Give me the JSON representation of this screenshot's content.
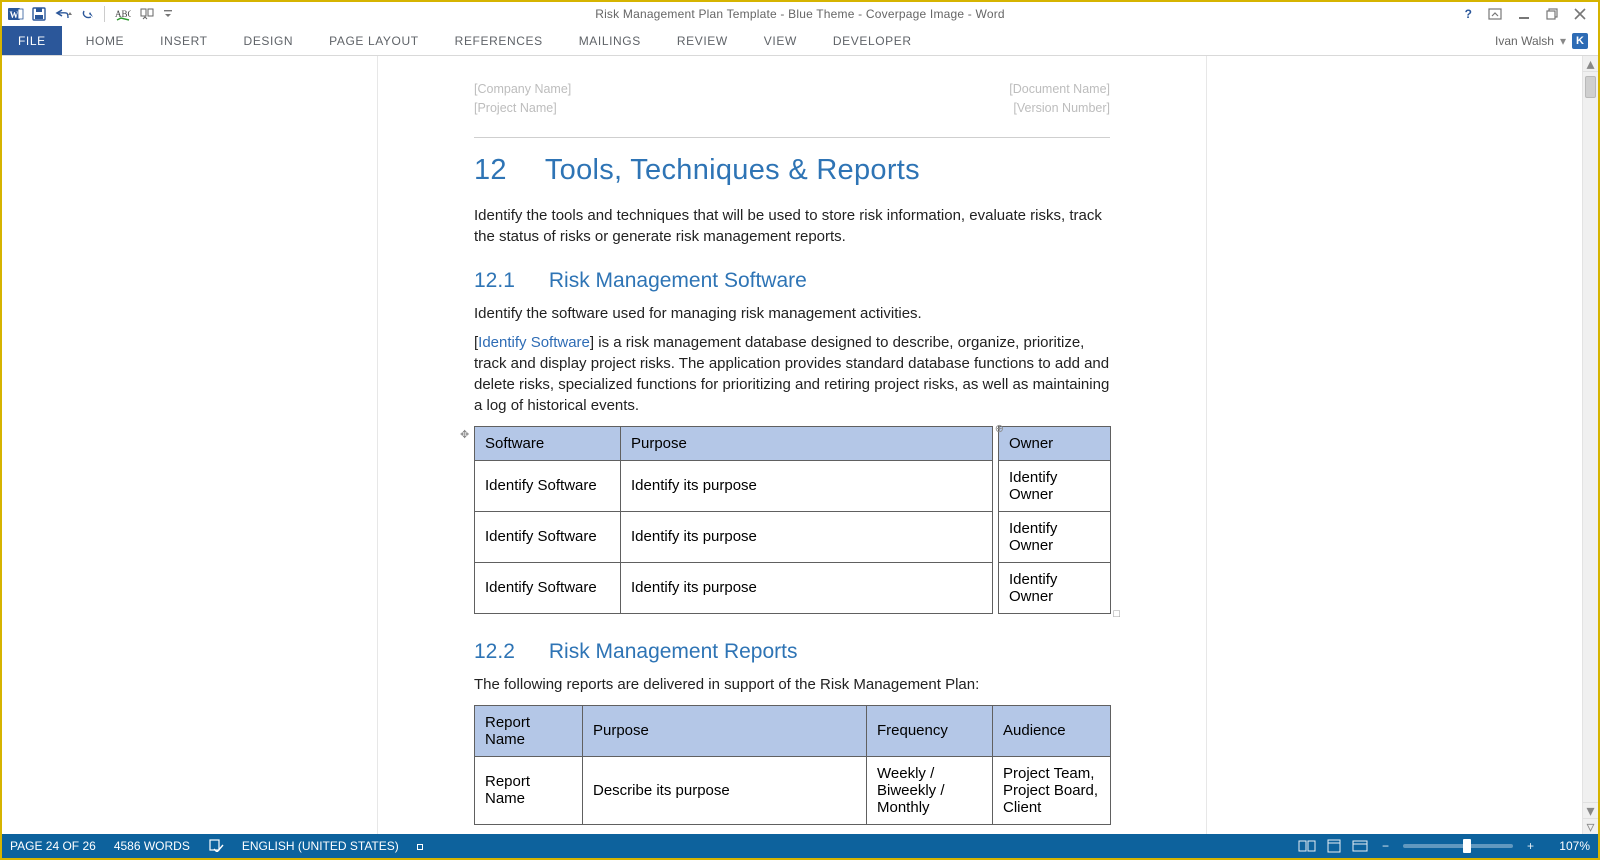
{
  "title_bar": {
    "title": "Risk Management Plan Template - Blue Theme - Coverpage Image - Word"
  },
  "ribbon": {
    "tabs": [
      "FILE",
      "HOME",
      "INSERT",
      "DESIGN",
      "PAGE LAYOUT",
      "REFERENCES",
      "MAILINGS",
      "REVIEW",
      "VIEW",
      "DEVELOPER"
    ],
    "user_name": "Ivan Walsh",
    "user_initial": "K"
  },
  "document": {
    "header": {
      "company": "[Company Name]",
      "project": "[Project Name]",
      "docname": "[Document Name]",
      "version": "[Version Number]"
    },
    "h1_num": "12",
    "h1_text": "Tools, Techniques & Reports",
    "p12_intro": "Identify the tools and techniques that will be used to store risk information, evaluate risks, track the status of risks or generate risk management reports.",
    "h121_num": "12.1",
    "h121_text": "Risk Management Software",
    "p121_a": "Identify the software used for managing risk management activities.",
    "p121_b_prefix": "[",
    "p121_b_field": "Identify Software",
    "p121_b_rest": "] is a risk management database designed to describe, organize, prioritize, track and display project risks. The application provides standard database functions to add and delete risks, specialized functions for prioritizing and retiring project risks, as well as maintaining a log of historical events.",
    "software_table": {
      "headers": [
        "Software",
        "Purpose",
        "Owner"
      ],
      "rows": [
        [
          "Identify Software",
          "Identify its purpose",
          "Identify Owner"
        ],
        [
          "Identify Software",
          "Identify its purpose",
          "Identify Owner"
        ],
        [
          "Identify Software",
          "Identify its purpose",
          "Identify Owner"
        ]
      ]
    },
    "h122_num": "12.2",
    "h122_text": "Risk Management Reports",
    "p122_a": "The following reports are delivered in support of the Risk Management Plan:",
    "reports_table": {
      "headers": [
        "Report Name",
        "Purpose",
        "Frequency",
        "Audience"
      ],
      "rows": [
        [
          "Report Name",
          "Describe its purpose",
          "Weekly / Biweekly / Monthly",
          "Project Team, Project Board, Client"
        ]
      ]
    }
  },
  "status_bar": {
    "page": "PAGE 24 OF 26",
    "words": "4586 WORDS",
    "language": "ENGLISH (UNITED STATES)",
    "zoom": "107%"
  }
}
